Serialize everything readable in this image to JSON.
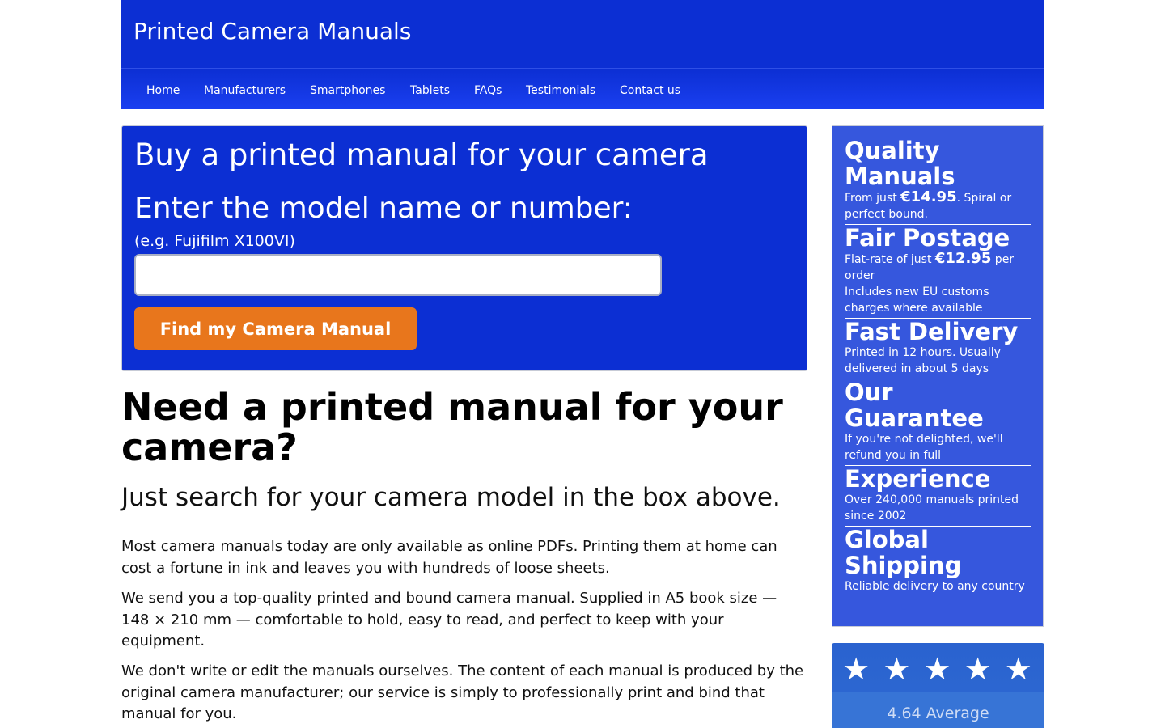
{
  "header": {
    "site_title": "Printed Camera Manuals"
  },
  "nav": {
    "items": [
      "Home",
      "Manufacturers",
      "Smartphones",
      "Tablets",
      "FAQs",
      "Testimonials",
      "Contact us"
    ]
  },
  "search": {
    "title": "Buy a printed manual for your camera",
    "label": "Enter the model name or number:",
    "hint": "(e.g. Fujifilm X100VI)",
    "input_value": "",
    "button_label": "Find my Camera Manual"
  },
  "main": {
    "heading": "Need a printed manual for your camera?",
    "subheading": "Just search for your camera model in the box above.",
    "paragraphs": [
      "Most camera manuals today are only available as online PDFs. Printing them at home can cost a fortune in ink and leaves you with hundreds of loose sheets.",
      "We send you a top-quality printed and bound camera manual. Supplied in A5 book size — 148 × 210 mm — comfortable to hold, easy to read, and perfect to keep with your equipment.",
      "We don't write or edit the manuals ourselves. The content of each manual is produced by the original camera manufacturer; our service is simply to professionally print and bind that manual for you."
    ]
  },
  "features": [
    {
      "title": "Quality Manuals",
      "text_before": "From just ",
      "price": "€14.95",
      "text_after": ". Spiral or perfect bound.",
      "text2": ""
    },
    {
      "title": "Fair Postage",
      "text_before": "Flat-rate of just ",
      "price": "€12.95",
      "text_after": " per order",
      "text2": "Includes new EU customs charges where available"
    },
    {
      "title": "Fast Delivery",
      "text_before": "Printed in 12 hours. Usually delivered in about 5 days",
      "price": "",
      "text_after": "",
      "text2": ""
    },
    {
      "title": "Our Guarantee",
      "text_before": "If you're not delighted, we'll refund you in full",
      "price": "",
      "text_after": "",
      "text2": ""
    },
    {
      "title": "Experience",
      "text_before": "Over 240,000 manuals printed since 2002",
      "price": "",
      "text_after": "",
      "text2": ""
    },
    {
      "title": "Global Shipping",
      "text_before": "Reliable delivery to any country",
      "price": "",
      "text_after": "",
      "text2": ""
    }
  ],
  "rating": {
    "stars": "★ ★ ★ ★ ★",
    "average_text": "4.64 Average",
    "average_value": 4.64,
    "colors": {
      "box": "#2a62cf"
    }
  },
  "colors": {
    "brand_blue": "#0c2fd3",
    "sidebar_blue": "#3657dd",
    "accent_orange": "#e8761c"
  }
}
